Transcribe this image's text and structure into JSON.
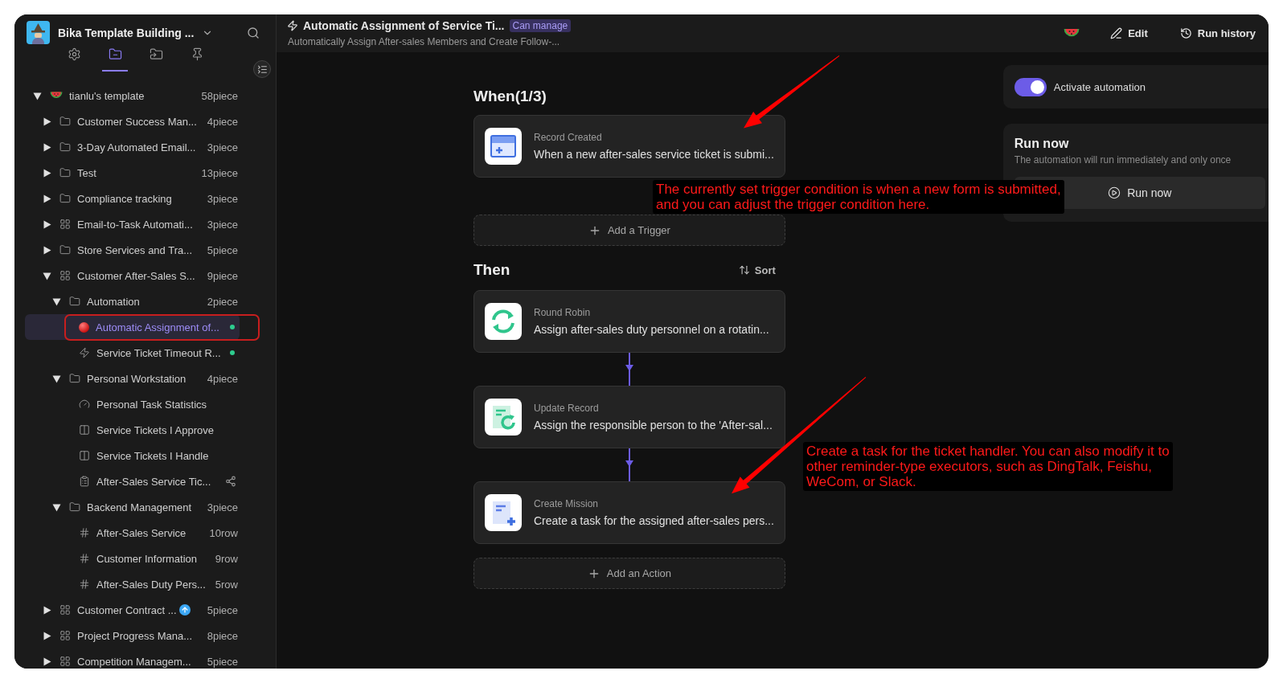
{
  "sidebar": {
    "space_name": "Bika Template Building ...",
    "tabs": [
      {
        "kind": "gear",
        "selected": false
      },
      {
        "kind": "folder",
        "selected": true
      },
      {
        "kind": "shared-folder",
        "selected": false
      },
      {
        "kind": "pin",
        "selected": false
      }
    ],
    "tree": {
      "label": "tianlu's template",
      "count": "58piece",
      "kind": "watermelon",
      "expanded": true,
      "selected": false,
      "children": [
        {
          "label": "Customer Success Man...",
          "count": "4piece",
          "kind": "folder",
          "expanded": false,
          "selected": false
        },
        {
          "label": "3-Day Automated Email...",
          "count": "3piece",
          "kind": "folder",
          "expanded": false,
          "selected": false
        },
        {
          "label": "Test",
          "count": "13piece",
          "kind": "folder",
          "expanded": false,
          "selected": false
        },
        {
          "label": "Compliance tracking",
          "count": "3piece",
          "kind": "folder",
          "expanded": false,
          "selected": false
        },
        {
          "label": "Email-to-Task Automati...",
          "count": "3piece",
          "kind": "grid",
          "expanded": false,
          "selected": false
        },
        {
          "label": "Store Services and Tra...",
          "count": "5piece",
          "kind": "folder",
          "expanded": false,
          "selected": false
        },
        {
          "label": "Customer After-Sales S...",
          "count": "9piece",
          "kind": "grid",
          "expanded": true,
          "selected": false,
          "children": [
            {
              "label": "Automation",
              "count": "2piece",
              "kind": "folder",
              "expanded": true,
              "selected": false,
              "children": [
                {
                  "label": "Automatic Assignment of...",
                  "kind": "ball",
                  "selected": true,
                  "active": true,
                  "outlined": true
                },
                {
                  "label": "Service Ticket Timeout R...",
                  "kind": "automation",
                  "selected": false,
                  "active": true
                }
              ]
            },
            {
              "label": "Personal Workstation",
              "count": "4piece",
              "kind": "folder",
              "expanded": true,
              "selected": false,
              "children": [
                {
                  "label": "Personal Task Statistics",
                  "kind": "dashboard",
                  "selected": false
                },
                {
                  "label": "Service Tickets I Approve",
                  "kind": "kanban",
                  "selected": false
                },
                {
                  "label": "Service Tickets I Handle",
                  "kind": "kanban",
                  "selected": false
                },
                {
                  "label": "After-Sales Service Tic...",
                  "kind": "form",
                  "selected": false,
                  "shared": true
                }
              ]
            },
            {
              "label": "Backend Management",
              "count": "3piece",
              "kind": "folder",
              "expanded": true,
              "selected": false,
              "children": [
                {
                  "label": "After-Sales Service",
                  "count": "10row",
                  "kind": "table",
                  "selected": false
                },
                {
                  "label": "Customer Information",
                  "count": "9row",
                  "kind": "table",
                  "selected": false
                },
                {
                  "label": "After-Sales Duty Pers...",
                  "count": "5row",
                  "kind": "table",
                  "selected": false
                }
              ]
            }
          ]
        },
        {
          "label": "Customer Contract ...",
          "count": "5piece",
          "kind": "grid",
          "expanded": false,
          "selected": false,
          "uploading": true
        },
        {
          "label": "Project Progress Mana...",
          "count": "8piece",
          "kind": "grid",
          "expanded": false,
          "selected": false
        },
        {
          "label": "Competition Managem...",
          "count": "5piece",
          "kind": "grid",
          "expanded": false,
          "selected": false
        }
      ]
    }
  },
  "header": {
    "title": "Automatic Assignment of Service Ti...",
    "badge": "Can manage",
    "subtitle": "Automatically Assign After-sales Members and Create Follow-...",
    "actions": [
      {
        "kind": "watermelon"
      },
      {
        "kind": "edit",
        "label": "Edit"
      },
      {
        "kind": "history",
        "label": "Run history"
      }
    ]
  },
  "flow": {
    "when_title": "When(1/3)",
    "triggers": [
      {
        "kind": "record-created",
        "title": "Record Created",
        "description": "When a new after-sales service ticket is submi...",
        "callout": "The currently set trigger condition is when a new form is submitted,\nand you can adjust the trigger condition here."
      }
    ],
    "add_trigger": "Add a Trigger",
    "then_title": "Then",
    "sort": "Sort",
    "actions": [
      {
        "kind": "round-robin",
        "title": "Round Robin",
        "description": "Assign after-sales duty personnel on a rotatin..."
      },
      {
        "kind": "update-record",
        "title": "Update Record",
        "description": "Assign the responsible person to the 'After-sal..."
      },
      {
        "kind": "create-mission",
        "title": "Create Mission",
        "description": "Create a task for the assigned after-sales pers...",
        "callout": "Create a task for the ticket handler. You can also modify it to\nother reminder-type executors, such as DingTalk, Feishu,\nWeCom, or Slack."
      }
    ],
    "add_action": "Add an Action"
  },
  "panel": {
    "activate": {
      "label": "Activate automation",
      "on": true
    },
    "run_now": {
      "title": "Run now",
      "description": "The automation will run immediately and only once",
      "button": "Run now"
    }
  }
}
